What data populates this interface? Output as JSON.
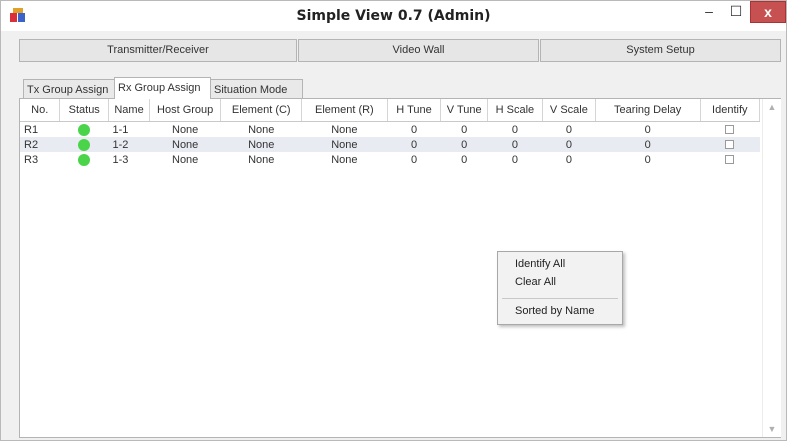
{
  "window": {
    "title": "Simple View 0.7 (Admin)",
    "controls": {
      "minimize": "–",
      "maximize": "☐",
      "close": "x"
    }
  },
  "nav": {
    "buttons": [
      "Transmitter/Receiver",
      "Video Wall",
      "System Setup"
    ]
  },
  "tabs": [
    "Tx Group Assign",
    "Rx Group Assign",
    "Situation Mode"
  ],
  "active_tab": "Rx Group Assign",
  "table": {
    "columns": [
      "No.",
      "Status",
      "Name",
      "Host Group",
      "Element (C)",
      "Element (R)",
      "H Tune",
      "V Tune",
      "H Scale",
      "V Scale",
      "Tearing Delay",
      "Identify"
    ],
    "rows": [
      {
        "no": "R1",
        "status": "online",
        "name": "1-1",
        "host_group": "None",
        "element_c": "None",
        "element_r": "None",
        "h_tune": "0",
        "v_tune": "0",
        "h_scale": "0",
        "v_scale": "0",
        "tearing_delay": "0",
        "identify": false
      },
      {
        "no": "R2",
        "status": "online",
        "name": "1-2",
        "host_group": "None",
        "element_c": "None",
        "element_r": "None",
        "h_tune": "0",
        "v_tune": "0",
        "h_scale": "0",
        "v_scale": "0",
        "tearing_delay": "0",
        "identify": false
      },
      {
        "no": "R3",
        "status": "online",
        "name": "1-3",
        "host_group": "None",
        "element_c": "None",
        "element_r": "None",
        "h_tune": "0",
        "v_tune": "0",
        "h_scale": "0",
        "v_scale": "0",
        "tearing_delay": "0",
        "identify": false
      }
    ],
    "status_color": "#49d44a"
  },
  "context_menu": {
    "items": [
      "Identify All",
      "Clear All",
      "Sorted by Name"
    ]
  }
}
